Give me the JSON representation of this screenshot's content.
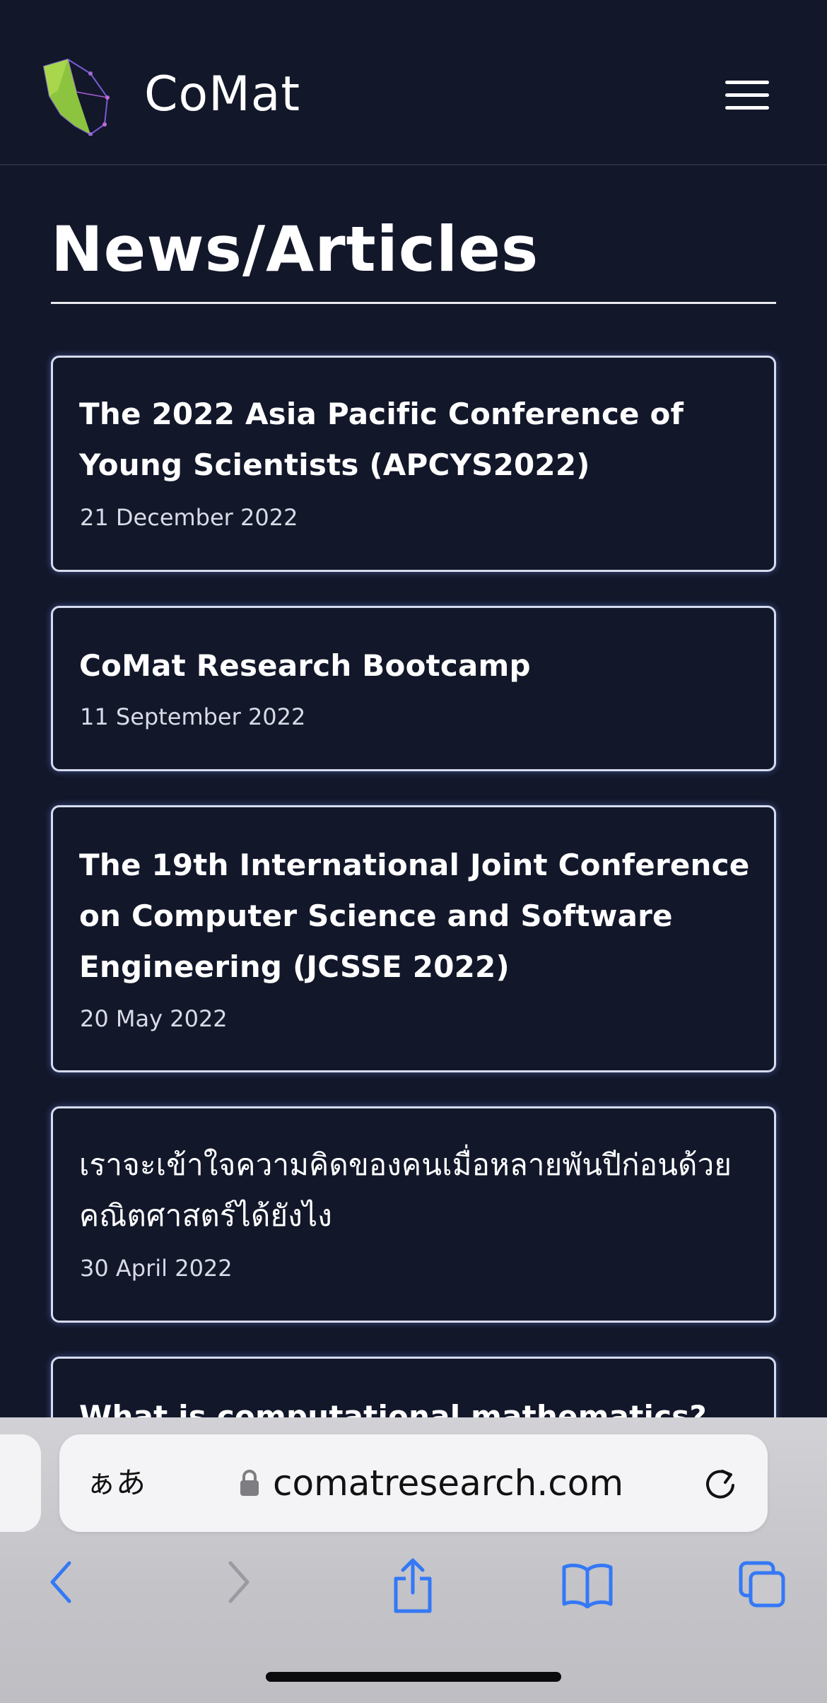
{
  "header": {
    "brand": "CoMat",
    "logo_icon": "comat-leaf-network-logo",
    "menu_icon": "hamburger-menu-icon"
  },
  "main": {
    "title": "News/Articles",
    "articles": [
      {
        "title": "The 2022 Asia Pacific Conference of Young Scientists (APCYS2022)",
        "date": "21 December 2022"
      },
      {
        "title": "CoMat Research Bootcamp",
        "date": "11 September 2022"
      },
      {
        "title": "The 19th International Joint Conference on Computer Science and Software Engineering (JCSSE 2022)",
        "date": "20 May 2022"
      },
      {
        "title": "เราจะเข้าใจความคิดของคนเมื่อหลายพันปีก่อนด้วยคณิตศาสตร์ได้ยังไง",
        "date": "30 April 2022"
      },
      {
        "title": "What is computational mathematics?",
        "date": ""
      }
    ]
  },
  "browser": {
    "text_size_label": "ぁあ",
    "url": "comatresearch.com",
    "icons": {
      "lock": "lock-icon",
      "reload": "reload-icon",
      "back": "back-chevron-icon",
      "forward": "forward-chevron-icon",
      "share": "share-icon",
      "bookmarks": "bookmarks-book-icon",
      "tabs": "tabs-icon"
    },
    "colors": {
      "accent": "#3478f6",
      "disabled": "#9a9aa0"
    }
  },
  "colors": {
    "page_background": "#12172a",
    "card_border": "#d7dbef",
    "text": "#ffffff",
    "date_text": "#d8dbe6"
  }
}
